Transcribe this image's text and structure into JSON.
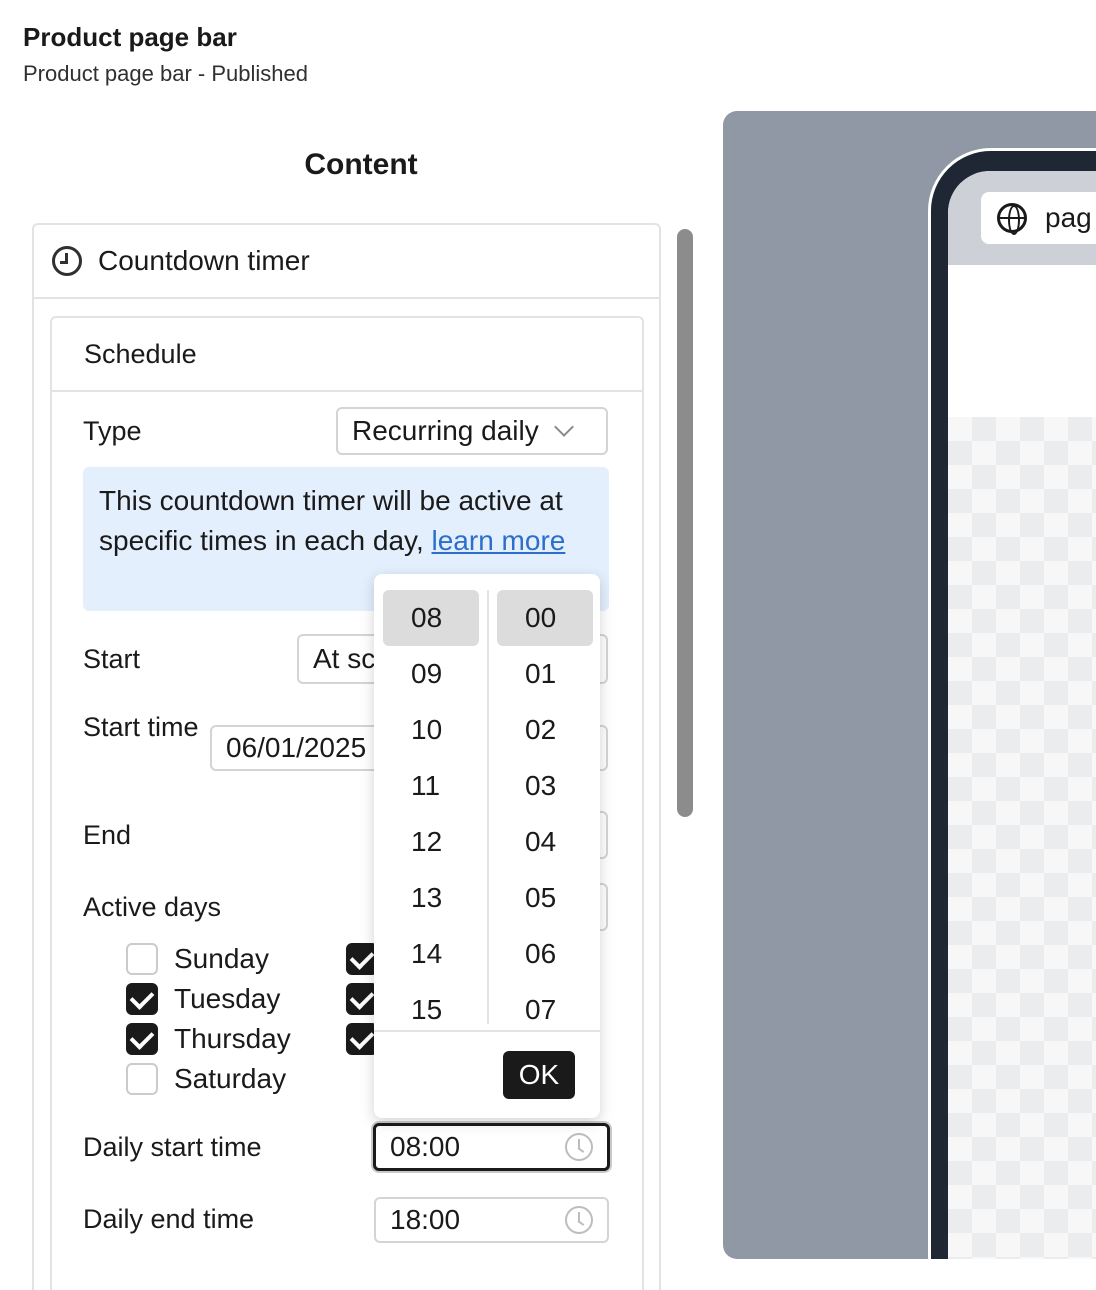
{
  "header": {
    "title": "Product page bar",
    "subtitle": "Product page bar - Published"
  },
  "content_heading": "Content",
  "section": {
    "title": "Countdown timer",
    "icon": "clock-icon"
  },
  "schedule": {
    "title": "Schedule",
    "type_label": "Type",
    "type_value": "Recurring daily",
    "info_text": "This countdown timer will be active at specific times in each day, ",
    "info_link": "learn more",
    "start_label": "Start",
    "start_value": "At sc",
    "start_time_label": "Start time",
    "start_time_value": "06/01/2025",
    "end_label": "End",
    "active_days_label": "Active days",
    "days": [
      {
        "label": "Sunday",
        "checked": false
      },
      {
        "label": "Tuesday",
        "checked": true
      },
      {
        "label": "Thursday",
        "checked": true
      },
      {
        "label": "Saturday",
        "checked": false
      }
    ],
    "hidden_column_checked": [
      true,
      true,
      true
    ],
    "daily_start_label": "Daily start time",
    "daily_start_value": "08:00",
    "daily_end_label": "Daily end time",
    "daily_end_value": "18:00"
  },
  "time_picker": {
    "hours": [
      "08",
      "09",
      "10",
      "11",
      "12",
      "13",
      "14",
      "15"
    ],
    "minutes": [
      "00",
      "01",
      "02",
      "03",
      "04",
      "05",
      "06",
      "07"
    ],
    "selected_hour": "08",
    "selected_minute": "00",
    "ok_label": "OK"
  },
  "preview": {
    "url_text": "pag",
    "icon": "globe-icon"
  },
  "colors": {
    "info_bg": "#e4effd",
    "link": "#2c6ecb",
    "preview_bg": "#9198a5",
    "phone_frame": "#1e2733"
  }
}
